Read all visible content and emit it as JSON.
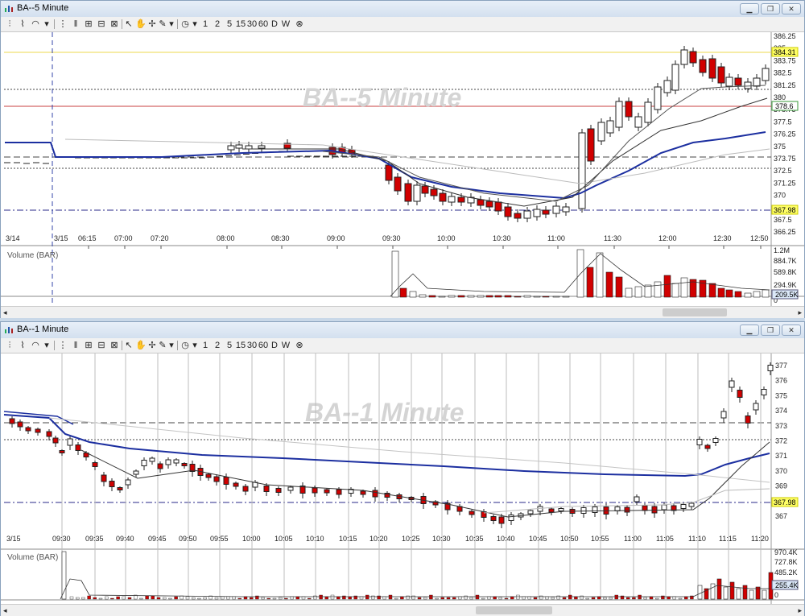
{
  "windows": {
    "five": {
      "title": "BA--5 Minute",
      "watermark": "BA--5 Minute",
      "volume_label": "Volume (BAR)",
      "date_labels": [
        "3/14",
        "3/15"
      ],
      "time_labels": [
        "06:15",
        "07:00",
        "07:20",
        "08:00",
        "08:30",
        "09:00",
        "09:30",
        "10:00",
        "10:30",
        "11:00",
        "11:30",
        "12:00",
        "12:30",
        "12:50"
      ],
      "price_ticks": [
        "386.25",
        "385",
        "383.75",
        "382.5",
        "381.25",
        "380",
        "378.75",
        "377.5",
        "376.25",
        "375",
        "373.75",
        "372.5",
        "371.25",
        "370",
        "368.75",
        "367.5",
        "366.25"
      ],
      "price_tags": {
        "yellow": "384.31",
        "green": "378.6",
        "ref": "367.98"
      },
      "volume_ticks": [
        "1.2M",
        "884.7K",
        "589.8K",
        "294.9K",
        "0"
      ],
      "volume_tag": "209.5K"
    },
    "one": {
      "title": "BA--1 Minute",
      "watermark": "BA--1 Minute",
      "volume_label": "Volume (BAR)",
      "date_labels": [
        "3/15"
      ],
      "time_labels": [
        "09:30",
        "09:35",
        "09:40",
        "09:45",
        "09:50",
        "09:55",
        "10:00",
        "10:05",
        "10:10",
        "10:15",
        "10:20",
        "10:25",
        "10:30",
        "10:35",
        "10:40",
        "10:45",
        "10:50",
        "10:55",
        "11:00",
        "11:05",
        "11:10",
        "11:15",
        "11:20"
      ],
      "price_ticks": [
        "377",
        "376",
        "375",
        "374",
        "373",
        "372",
        "371",
        "370",
        "369",
        "368",
        "367"
      ],
      "price_tags": {
        "ref": "367.98"
      },
      "volume_ticks": [
        "970.4K",
        "727.8K",
        "485.2K",
        "242.6K",
        "0"
      ],
      "volume_tag": "255.4K"
    }
  },
  "toolbar": {
    "intervals": [
      "1",
      "2",
      "5",
      "15",
      "30",
      "60",
      "D",
      "W"
    ]
  },
  "colors": {
    "up": "#ffffff",
    "down": "#d10000",
    "ma_blue": "#1c2fa0",
    "ref_yellow": "#ffff66",
    "tag_green": "#3a9a3a"
  }
}
